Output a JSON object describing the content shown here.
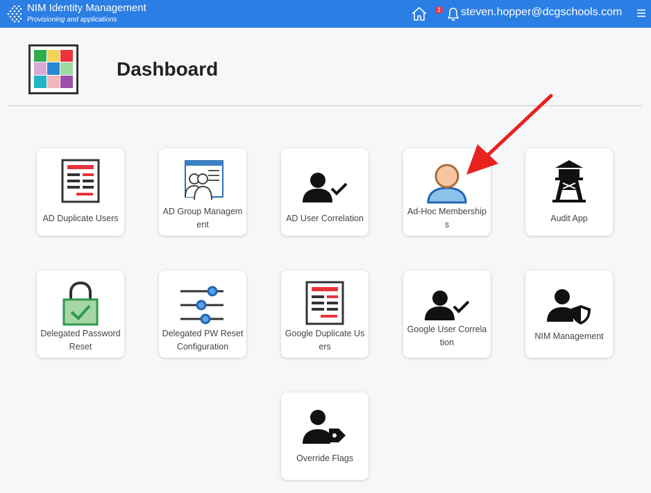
{
  "header": {
    "app_title": "NIM Identity Management",
    "app_subtitle": "Provisioning and applications",
    "notification_count": "2",
    "user_email": "steven.hopper@dcgschools.com",
    "bg_color": "#2b7ee3"
  },
  "page": {
    "title": "Dashboard"
  },
  "apps": [
    {
      "label": "AD Duplicate Users",
      "icon": "document-list-icon"
    },
    {
      "label": "AD Group Management",
      "icon": "group-window-icon"
    },
    {
      "label": "AD User Correlation",
      "icon": "user-check-icon"
    },
    {
      "label": "Ad-Hoc Memberships",
      "icon": "person-avatar-icon"
    },
    {
      "label": "Audit App",
      "icon": "watchtower-icon"
    },
    {
      "label": "Delegated Password Reset",
      "icon": "padlock-check-icon"
    },
    {
      "label": "Delegated PW Reset Configuration",
      "icon": "sliders-icon"
    },
    {
      "label": "Google Duplicate Users",
      "icon": "document-list-icon"
    },
    {
      "label": "Google User Correlation",
      "icon": "user-check-icon"
    },
    {
      "label": "NIM Management",
      "icon": "user-shield-icon"
    },
    {
      "label": "Override Flags",
      "icon": "user-tag-icon"
    }
  ],
  "annotation": {
    "arrow_color": "#e8221e"
  }
}
